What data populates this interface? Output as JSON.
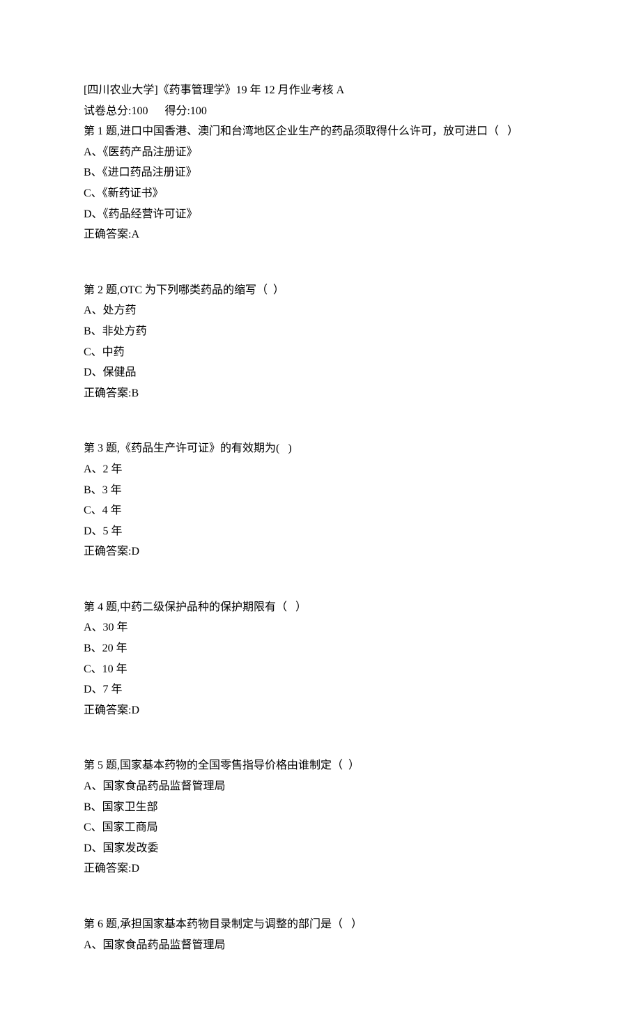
{
  "header": {
    "title": "[四川农业大学]《药事管理学》19 年 12 月作业考核 A",
    "totalScoreLabel": "试卷总分:100",
    "gotScoreLabel": "得分:100"
  },
  "questions": [
    {
      "label": "第 1 题,进口中国香港、澳门和台湾地区企业生产的药品须取得什么许可，放可进口（   ）",
      "options": [
        "A、《医药产品注册证》",
        "B、《进口药品注册证》",
        "C、《新药证书》",
        "D、《药品经营许可证》"
      ],
      "answer": "正确答案:A"
    },
    {
      "label": "第 2 题,OTC 为下列哪类药品的缩写（  ）",
      "options": [
        "A、处方药",
        "B、非处方药",
        "C、中药",
        "D、保健品"
      ],
      "answer": "正确答案:B"
    },
    {
      "label": "第 3 题,《药品生产许可证》的有效期为(   )",
      "options": [
        "A、2 年",
        "B、3 年",
        "C、4 年",
        "D、5 年"
      ],
      "answer": "正确答案:D"
    },
    {
      "label": "第 4 题,中药二级保护品种的保护期限有（   ）",
      "options": [
        "A、30 年",
        "B、20 年",
        "C、10 年",
        "D、7 年"
      ],
      "answer": "正确答案:D"
    },
    {
      "label": "第 5 题,国家基本药物的全国零售指导价格由谁制定（  ）",
      "options": [
        "A、国家食品药品监督管理局",
        "B、国家卫生部",
        "C、国家工商局",
        "D、国家发改委"
      ],
      "answer": "正确答案:D"
    },
    {
      "label": "第 6 题,承担国家基本药物目录制定与调整的部门是（   ）",
      "options": [
        "A、国家食品药品监督管理局"
      ],
      "answer": ""
    }
  ]
}
